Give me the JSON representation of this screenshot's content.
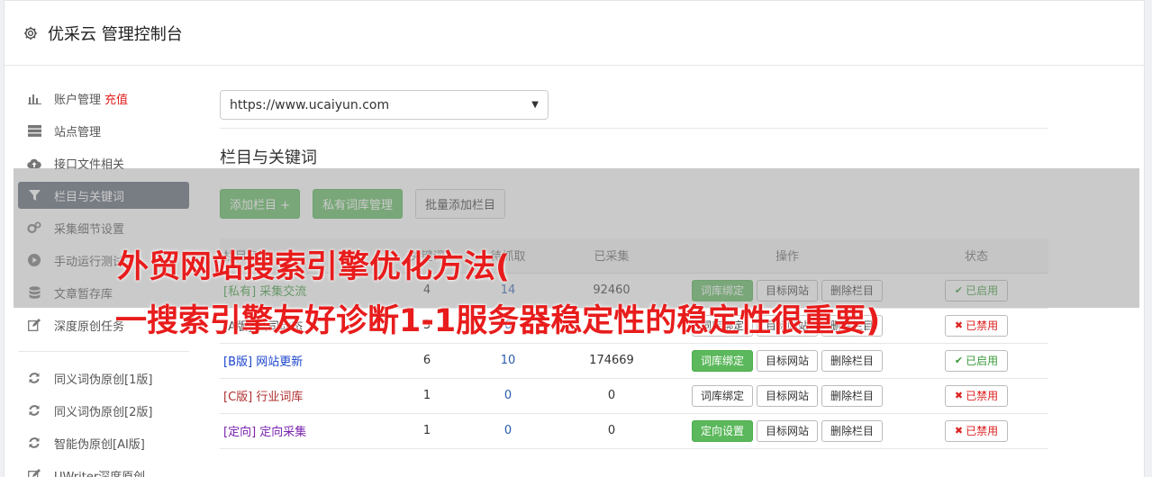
{
  "app": {
    "title": "优采云 管理控制台"
  },
  "sidebar": {
    "items": [
      {
        "label": "账户管理",
        "badge": "充值",
        "icon": "bar-chart-icon"
      },
      {
        "label": "站点管理",
        "icon": "server-icon"
      },
      {
        "label": "接口文件相关",
        "icon": "cloud-upload-icon"
      },
      {
        "label": "栏目与关键词",
        "icon": "filter-icon",
        "active": true
      },
      {
        "label": "采集细节设置",
        "icon": "gears-icon"
      },
      {
        "label": "手动运行测试",
        "icon": "play-circle-icon"
      },
      {
        "label": "文章暂存库",
        "icon": "database-icon"
      },
      {
        "label": "深度原创任务",
        "icon": "edit-icon"
      }
    ],
    "items2": [
      {
        "label": "同义词伪原创[1版]",
        "icon": "refresh-icon"
      },
      {
        "label": "同义词伪原创[2版]",
        "icon": "refresh-icon"
      },
      {
        "label": "智能伪原创[AI版]",
        "icon": "refresh-icon"
      },
      {
        "label": "UWriter深度原创",
        "icon": "edit-icon"
      }
    ]
  },
  "main": {
    "site_select": "https://www.ucaiyun.com",
    "section_title": "栏目与关键词",
    "buttons": {
      "add_column": "添加栏目 +",
      "private_lib": "私有词库管理",
      "batch_add": "批量添加栏目"
    },
    "table": {
      "headers": [
        "栏目名称",
        "关键词",
        "待抓取",
        "已采集",
        "操作",
        "状态"
      ],
      "rows": [
        {
          "tag": "[私有]",
          "name": "采集交流",
          "kw": "4",
          "pending": "14",
          "collected": "92460",
          "op1": "词库绑定",
          "op1_green": true,
          "op2": "目标网站",
          "op3": "删除栏目",
          "status": "已启用",
          "on": true,
          "tagclass": "tag-private"
        },
        {
          "tag": "[A版]",
          "name": "公司动态",
          "kw": "3",
          "pending": "6",
          "collected": "",
          "op1": "词库绑定",
          "op1_green": false,
          "op2": "目标网站",
          "op3": "删除栏目",
          "status": "已禁用",
          "on": false,
          "tagclass": "tag-a"
        },
        {
          "tag": "[B版]",
          "name": "网站更新",
          "kw": "6",
          "pending": "10",
          "collected": "174669",
          "op1": "词库绑定",
          "op1_green": true,
          "op2": "目标网站",
          "op3": "删除栏目",
          "status": "已启用",
          "on": true,
          "tagclass": "tag-b"
        },
        {
          "tag": "[C版]",
          "name": "行业词库",
          "kw": "1",
          "pending": "0",
          "collected": "0",
          "op1": "词库绑定",
          "op1_green": false,
          "op2": "目标网站",
          "op3": "删除栏目",
          "status": "已禁用",
          "on": false,
          "tagclass": "tag-c"
        },
        {
          "tag": "[定向]",
          "name": "定向采集",
          "kw": "1",
          "pending": "0",
          "collected": "0",
          "op1": "定向设置",
          "op1_green": true,
          "op2": "目标网站",
          "op3": "删除栏目",
          "status": "已禁用",
          "on": false,
          "tagclass": "tag-d"
        }
      ]
    }
  },
  "overlay": {
    "line1": "外贸网站搜索引擎优化方法(",
    "line2": "一搜索引擎友好诊断1-1服务器稳定性的稳定性很重要)"
  },
  "colors": {
    "accent_green": "#5cb85c",
    "active_nav": "#5b6370",
    "overlay_red": "#e81c1c"
  }
}
